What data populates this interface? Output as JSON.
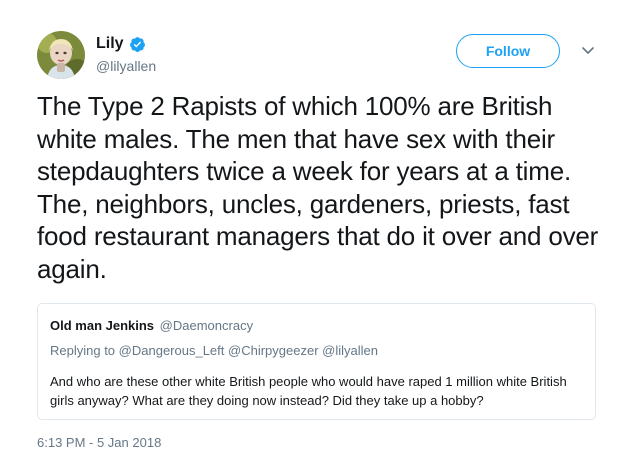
{
  "author": {
    "display_name": "Lily",
    "handle": "@lilyallen",
    "verified_icon": "verified-badge-icon",
    "avatar_icon": "avatar"
  },
  "actions": {
    "follow_label": "Follow",
    "more_icon": "chevron-down-icon"
  },
  "tweet": {
    "text": "The Type 2 Rapists of which 100% are British white males. The men that have sex with their stepdaughters twice a week for years at a time. The, neighbors, uncles, gardeners, priests, fast food restaurant managers that do it over and over again.",
    "timestamp": "6:13 PM - 5 Jan 2018"
  },
  "quoted_tweet": {
    "display_name": "Old man Jenkins",
    "handle": "@Daemoncracy",
    "replying_prefix": "Replying to",
    "replying_to": [
      "@Dangerous_Left",
      "@Chirpygeezer",
      "@lilyallen"
    ],
    "text": "And who are these other white British people who would have raped 1 million white British girls anyway? What are they doing now instead? Did they take up a hobby?"
  },
  "colors": {
    "accent": "#1da1f2",
    "text_primary": "#14171a",
    "text_secondary": "#657786",
    "border": "#e1e8ed"
  }
}
